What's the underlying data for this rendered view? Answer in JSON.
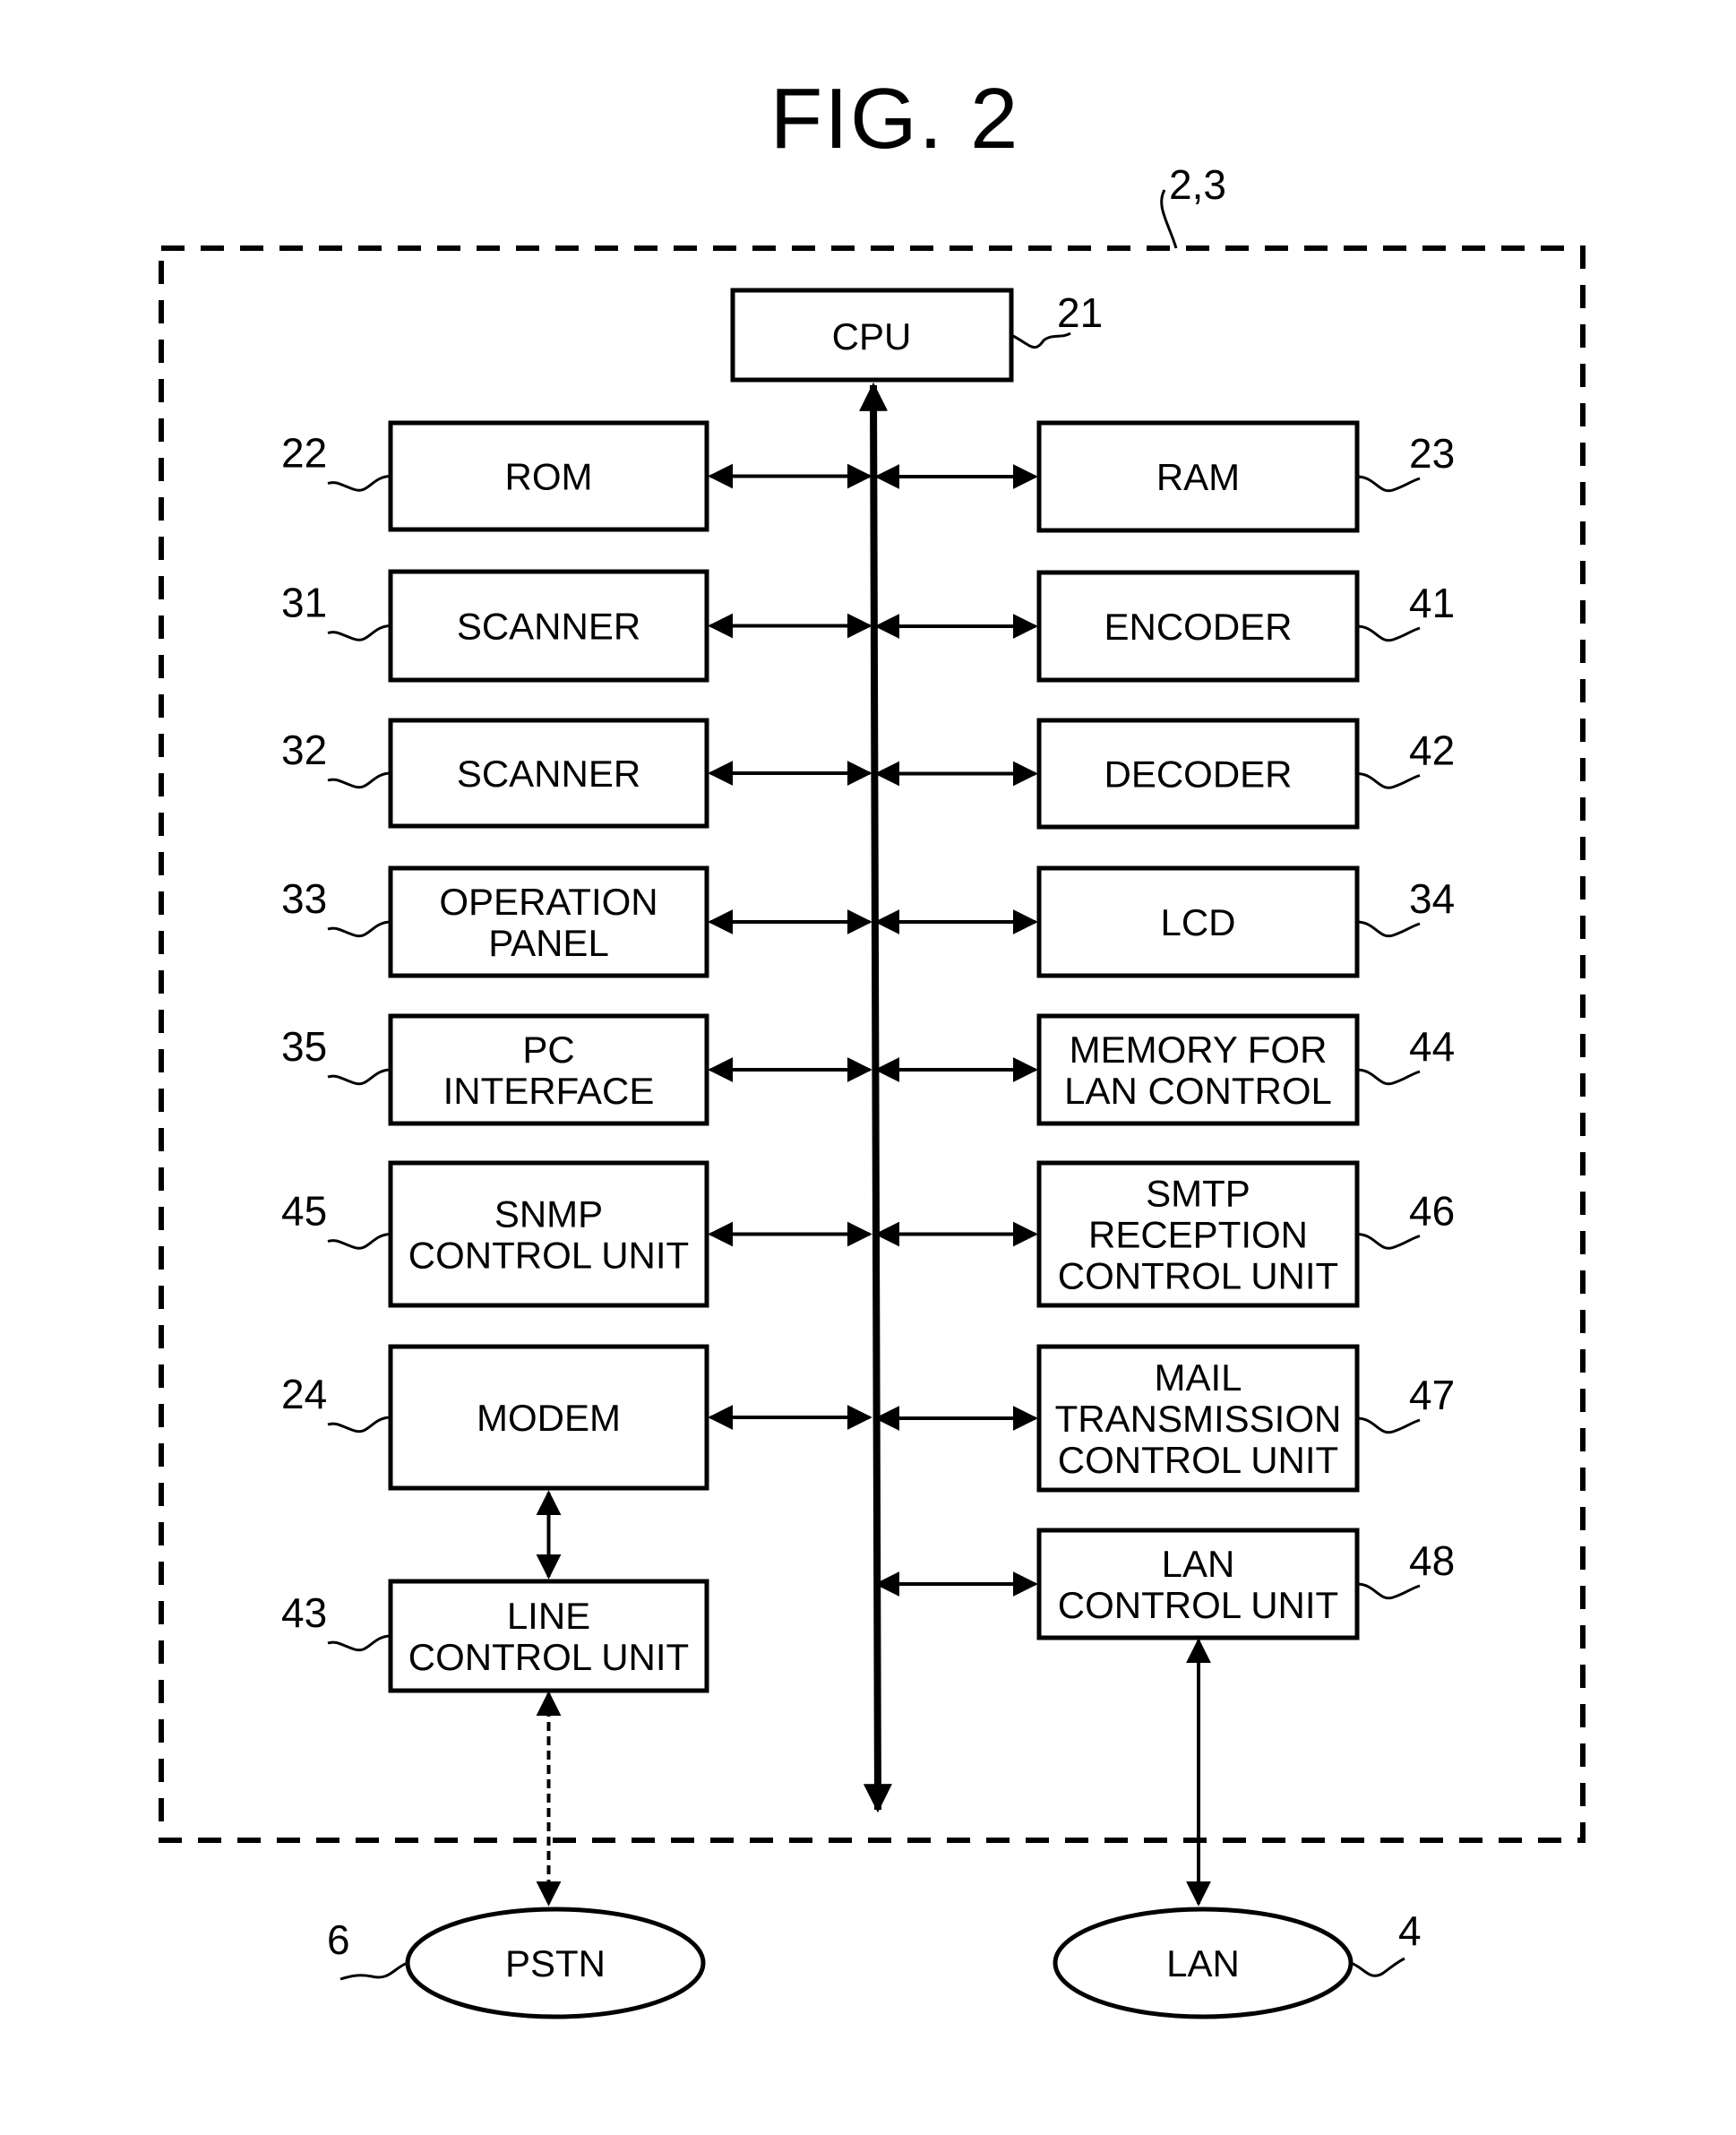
{
  "title": "FIG. 2",
  "device_ref": "2,3",
  "cpu": {
    "label": "CPU",
    "ref": "21"
  },
  "left_blocks": [
    {
      "lines": [
        "ROM"
      ],
      "ref": "22"
    },
    {
      "lines": [
        "SCANNER"
      ],
      "ref": "31"
    },
    {
      "lines": [
        "SCANNER"
      ],
      "ref": "32"
    },
    {
      "lines": [
        "OPERATION",
        "PANEL"
      ],
      "ref": "33"
    },
    {
      "lines": [
        "PC",
        "INTERFACE"
      ],
      "ref": "35"
    },
    {
      "lines": [
        "SNMP",
        "CONTROL UNIT"
      ],
      "ref": "45"
    },
    {
      "lines": [
        "MODEM"
      ],
      "ref": "24"
    },
    {
      "lines": [
        "LINE",
        "CONTROL UNIT"
      ],
      "ref": "43"
    }
  ],
  "right_blocks": [
    {
      "lines": [
        "RAM"
      ],
      "ref": "23"
    },
    {
      "lines": [
        "ENCODER"
      ],
      "ref": "41"
    },
    {
      "lines": [
        "DECODER"
      ],
      "ref": "42"
    },
    {
      "lines": [
        "LCD"
      ],
      "ref": "34"
    },
    {
      "lines": [
        "MEMORY FOR",
        "LAN CONTROL"
      ],
      "ref": "44"
    },
    {
      "lines": [
        "SMTP",
        "RECEPTION",
        "CONTROL UNIT"
      ],
      "ref": "46"
    },
    {
      "lines": [
        "MAIL",
        "TRANSMISSION",
        "CONTROL UNIT"
      ],
      "ref": "47"
    },
    {
      "lines": [
        "LAN",
        "CONTROL UNIT"
      ],
      "ref": "48"
    }
  ],
  "networks": [
    {
      "label": "PSTN",
      "ref": "6"
    },
    {
      "label": "LAN",
      "ref": "4"
    }
  ]
}
